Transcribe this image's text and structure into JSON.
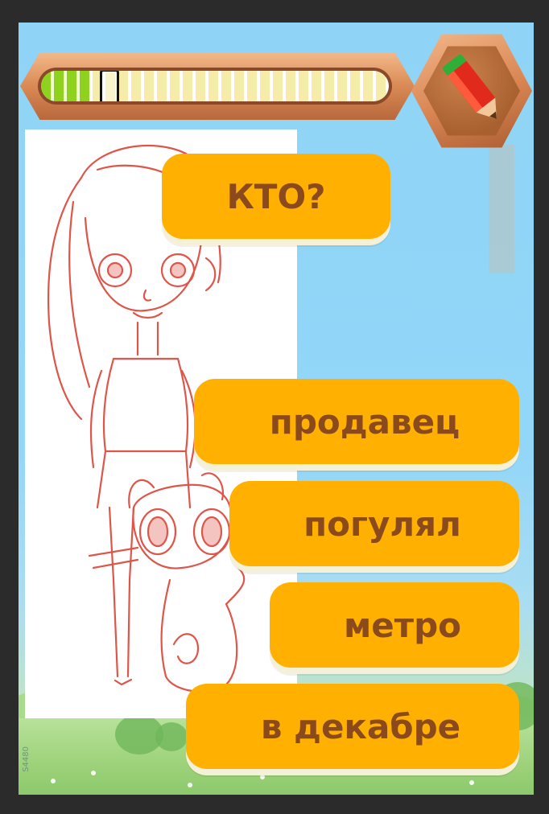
{
  "game": {
    "progress": {
      "filled_fraction": 0.14,
      "marker_fraction": 0.17
    },
    "question": "КТО?",
    "answer_options": [
      {
        "label": "продавец"
      },
      {
        "label": "погулял"
      },
      {
        "label": "метро"
      },
      {
        "label": "в декабре"
      }
    ],
    "watermark": "S4480",
    "colors": {
      "button": "#ffb000",
      "button_text": "#8a4a1c",
      "sky": "#8fd3f6",
      "progress_green": "#8ed11f",
      "frame": "#d98a55"
    },
    "icons": {
      "badge": "pencil-icon",
      "picture": "drawing-icon"
    }
  }
}
